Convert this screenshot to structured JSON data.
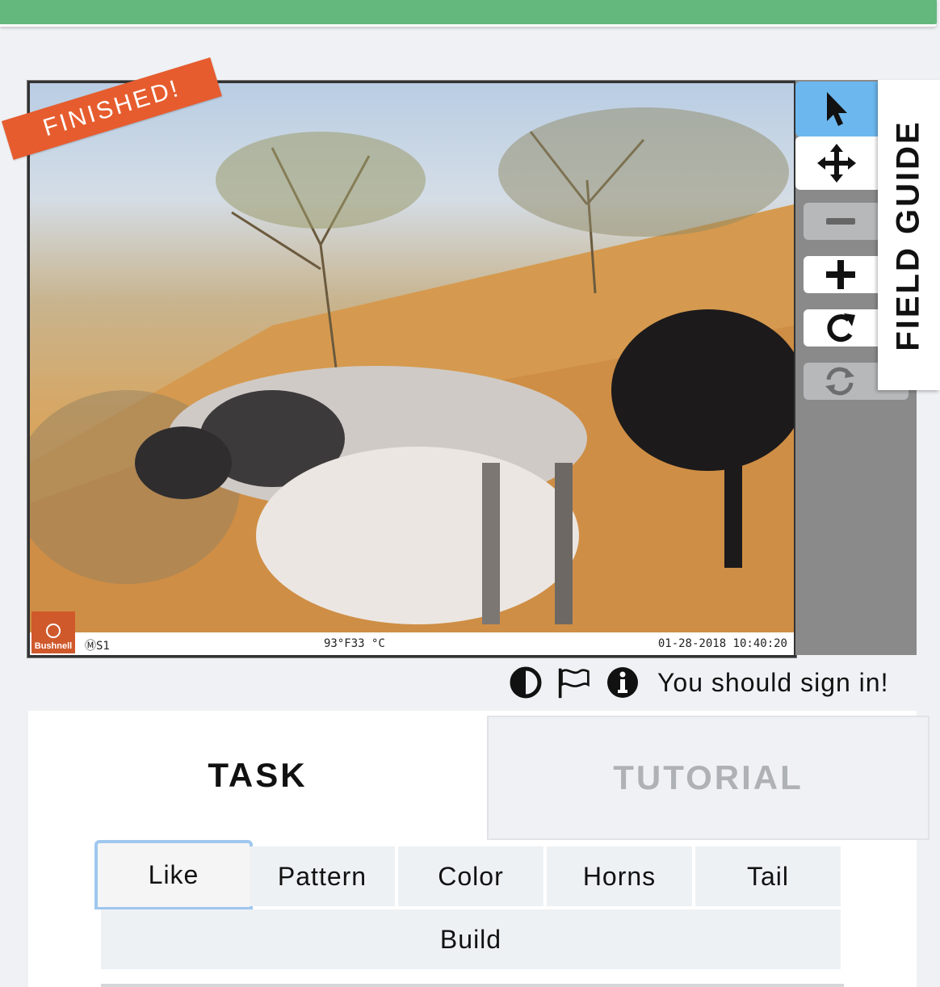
{
  "subject": {
    "status_ribbon": "FINISHED!",
    "camera_brand": "Bushnell",
    "camera_id": "ⓂS1",
    "temperature": "93°F33 °C",
    "timestamp": "01-28-2018 10:40:20"
  },
  "tools": {
    "items": [
      {
        "icon": "pointer-icon",
        "glyph": "↖",
        "active": true
      },
      {
        "icon": "move-icon",
        "glyph": "✥",
        "active": false
      },
      {
        "icon": "zoom-out-icon",
        "glyph": "−",
        "active": false
      },
      {
        "icon": "zoom-in-icon",
        "glyph": "+",
        "active": false
      },
      {
        "icon": "rotate-icon",
        "glyph": "↻",
        "active": false
      },
      {
        "icon": "reset-icon",
        "glyph": "⟳",
        "active": false
      }
    ]
  },
  "field_guide": {
    "label": "FIELD GUIDE"
  },
  "meta": {
    "signin_text": "You should sign in!"
  },
  "panel": {
    "tabs": {
      "task": "TASK",
      "tutorial": "TUTORIAL"
    },
    "question_tabs": [
      "Like",
      "Pattern",
      "Color",
      "Horns",
      "Tail",
      "Build"
    ],
    "selected_tab": "Like"
  },
  "colors": {
    "topbar": "#65b87d",
    "ribbon": "#e65c2e",
    "active_tool": "#6cb7ee"
  }
}
